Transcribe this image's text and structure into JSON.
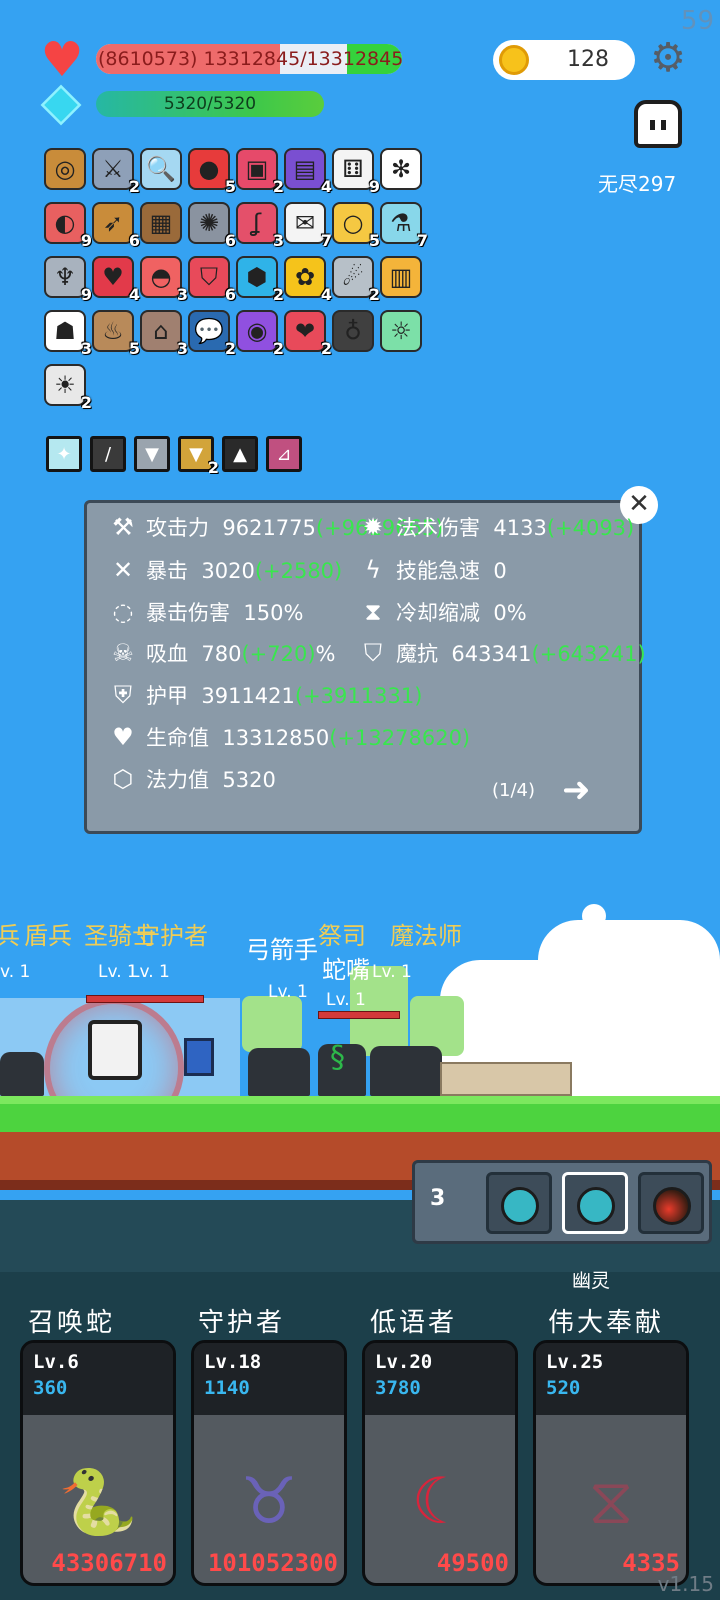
{
  "fps": "59",
  "hud": {
    "hp_text": "(8610573) 13312845/13312845",
    "mp_text": "5320/5320",
    "coins": "128",
    "endless": "无尽297"
  },
  "items": [
    {
      "icon": "shield-icon",
      "glyph": "◎",
      "count": ""
    },
    {
      "icon": "sword-icon",
      "glyph": "⚔",
      "count": "2"
    },
    {
      "icon": "magnifier-icon",
      "glyph": "🔍",
      "count": ""
    },
    {
      "icon": "apple-icon",
      "glyph": "●",
      "count": "5"
    },
    {
      "icon": "jam-jar-icon",
      "glyph": "▣",
      "count": "2"
    },
    {
      "icon": "chest-purple-icon",
      "glyph": "▤",
      "count": "4"
    },
    {
      "icon": "dice-icon",
      "glyph": "⚅",
      "count": "9"
    },
    {
      "icon": "snowflake-icon",
      "glyph": "✻",
      "count": ""
    },
    {
      "icon": "pill-icon",
      "glyph": "◐",
      "count": "9"
    },
    {
      "icon": "crossbow-icon",
      "glyph": "➶",
      "count": "6"
    },
    {
      "icon": "treasure-chest-icon",
      "glyph": "▦",
      "count": ""
    },
    {
      "icon": "spiked-ball-icon",
      "glyph": "✺",
      "count": "6"
    },
    {
      "icon": "hook-icon",
      "glyph": "ʆ",
      "count": "3"
    },
    {
      "icon": "envelope-icon",
      "glyph": "✉",
      "count": "7"
    },
    {
      "icon": "ring-icon",
      "glyph": "○",
      "count": "5"
    },
    {
      "icon": "potion-flask-icon",
      "glyph": "⚗",
      "count": "7"
    },
    {
      "icon": "axe-icon",
      "glyph": "♆",
      "count": "9"
    },
    {
      "icon": "strawberry-icon",
      "glyph": "♥",
      "count": "4"
    },
    {
      "icon": "watermelon-icon",
      "glyph": "◓",
      "count": "3"
    },
    {
      "icon": "badge-shield-icon",
      "glyph": "⛉",
      "count": "6"
    },
    {
      "icon": "gem-icon",
      "glyph": "⬢",
      "count": "2"
    },
    {
      "icon": "sunflower-icon",
      "glyph": "✿",
      "count": "4"
    },
    {
      "icon": "meteor-icon",
      "glyph": "☄",
      "count": "2"
    },
    {
      "icon": "book-icon",
      "glyph": "▥",
      "count": ""
    },
    {
      "icon": "ghost-icon",
      "glyph": "☗",
      "count": "3"
    },
    {
      "icon": "cupcake-icon",
      "glyph": "♨",
      "count": "5"
    },
    {
      "icon": "tombstone-icon",
      "glyph": "⌂",
      "count": "3"
    },
    {
      "icon": "speech-bubble-icon",
      "glyph": "💬",
      "count": "2"
    },
    {
      "icon": "crystal-ball-icon",
      "glyph": "◉",
      "count": "2"
    },
    {
      "icon": "hearts-icon",
      "glyph": "❤",
      "count": "2"
    },
    {
      "icon": "cauldron-icon",
      "glyph": "♁",
      "count": ""
    },
    {
      "icon": "lightbulb-green-icon",
      "glyph": "☼",
      "count": ""
    },
    {
      "icon": "lightbulb-icon",
      "glyph": "☀",
      "count": "2"
    }
  ],
  "equipment": [
    {
      "icon": "sparkle-gem-icon",
      "glyph": "✦",
      "count": ""
    },
    {
      "icon": "dagger-icon",
      "glyph": "/",
      "count": ""
    },
    {
      "icon": "armor-icon",
      "glyph": "▼",
      "count": ""
    },
    {
      "icon": "armor-gold-icon",
      "glyph": "▼",
      "count": "2"
    },
    {
      "icon": "dark-helmet-icon",
      "glyph": "▲",
      "count": ""
    },
    {
      "icon": "boots-icon",
      "glyph": "⊿",
      "count": ""
    }
  ],
  "stats": {
    "attack": {
      "label": "攻击力",
      "value": "9621775",
      "bonus": "(+9619665)"
    },
    "magic": {
      "label": "法术伤害",
      "value": "4133",
      "bonus": "(+4093)"
    },
    "crit": {
      "label": "暴击",
      "value": "3020",
      "bonus": "(+2580)"
    },
    "haste": {
      "label": "技能急速",
      "value": "0",
      "bonus": ""
    },
    "crit_dmg": {
      "label": "暴击伤害",
      "value": "150%",
      "bonus": ""
    },
    "cdr": {
      "label": "冷却缩减",
      "value": "0%",
      "bonus": ""
    },
    "lifesteal": {
      "label": "吸血",
      "value": "780",
      "bonus": "(+720)",
      "suffix": "%"
    },
    "mres": {
      "label": "魔抗",
      "value": "643341",
      "bonus": "(+643241)"
    },
    "armor": {
      "label": "护甲",
      "value": "3911421",
      "bonus": "(+3911331)"
    },
    "hp": {
      "label": "生命值",
      "value": "13312850",
      "bonus": "(+13278620)"
    },
    "mana": {
      "label": "法力值",
      "value": "5320",
      "bonus": ""
    },
    "page": "(1/4)"
  },
  "battle": {
    "names": [
      {
        "text": "兵",
        "cls": "unit-name"
      },
      {
        "text": "盾兵",
        "cls": "unit-name"
      },
      {
        "text": "圣骑士",
        "cls": "unit-name"
      },
      {
        "text": "守护者",
        "cls": "unit-name"
      },
      {
        "text": "弓箭手",
        "cls": "unit-name w"
      },
      {
        "text": "祭司",
        "cls": "unit-name"
      },
      {
        "text": "魔法师",
        "cls": "unit-name"
      },
      {
        "text": "蛇嘴",
        "cls": "unit-name w"
      }
    ],
    "lv_label": "Lv. 1",
    "lv_short": "v. 1"
  },
  "potions": {
    "count": "3",
    "selected_label": "幽灵"
  },
  "skills": [
    {
      "title": "召唤蛇",
      "lv": "Lv.6",
      "cost": "360",
      "dmg": "43306710",
      "icon": "snake-icon",
      "glyph": "🐍",
      "color": "#3ea35a"
    },
    {
      "title": "守护者",
      "lv": "Lv.18",
      "cost": "1140",
      "dmg": "101052300",
      "icon": "taurus-icon",
      "glyph": "♉",
      "color": "#6a62b8"
    },
    {
      "title": "低语者",
      "lv": "Lv.20",
      "cost": "3780",
      "dmg": "49500",
      "icon": "crescent-moon-icon",
      "glyph": "☾",
      "color": "#d8243c"
    },
    {
      "title": "伟大奉献",
      "lv": "Lv.25",
      "cost": "520",
      "dmg": "4335",
      "icon": "dna-icon",
      "glyph": "⧖",
      "color": "#8a4858"
    }
  ],
  "version": "v1.15"
}
